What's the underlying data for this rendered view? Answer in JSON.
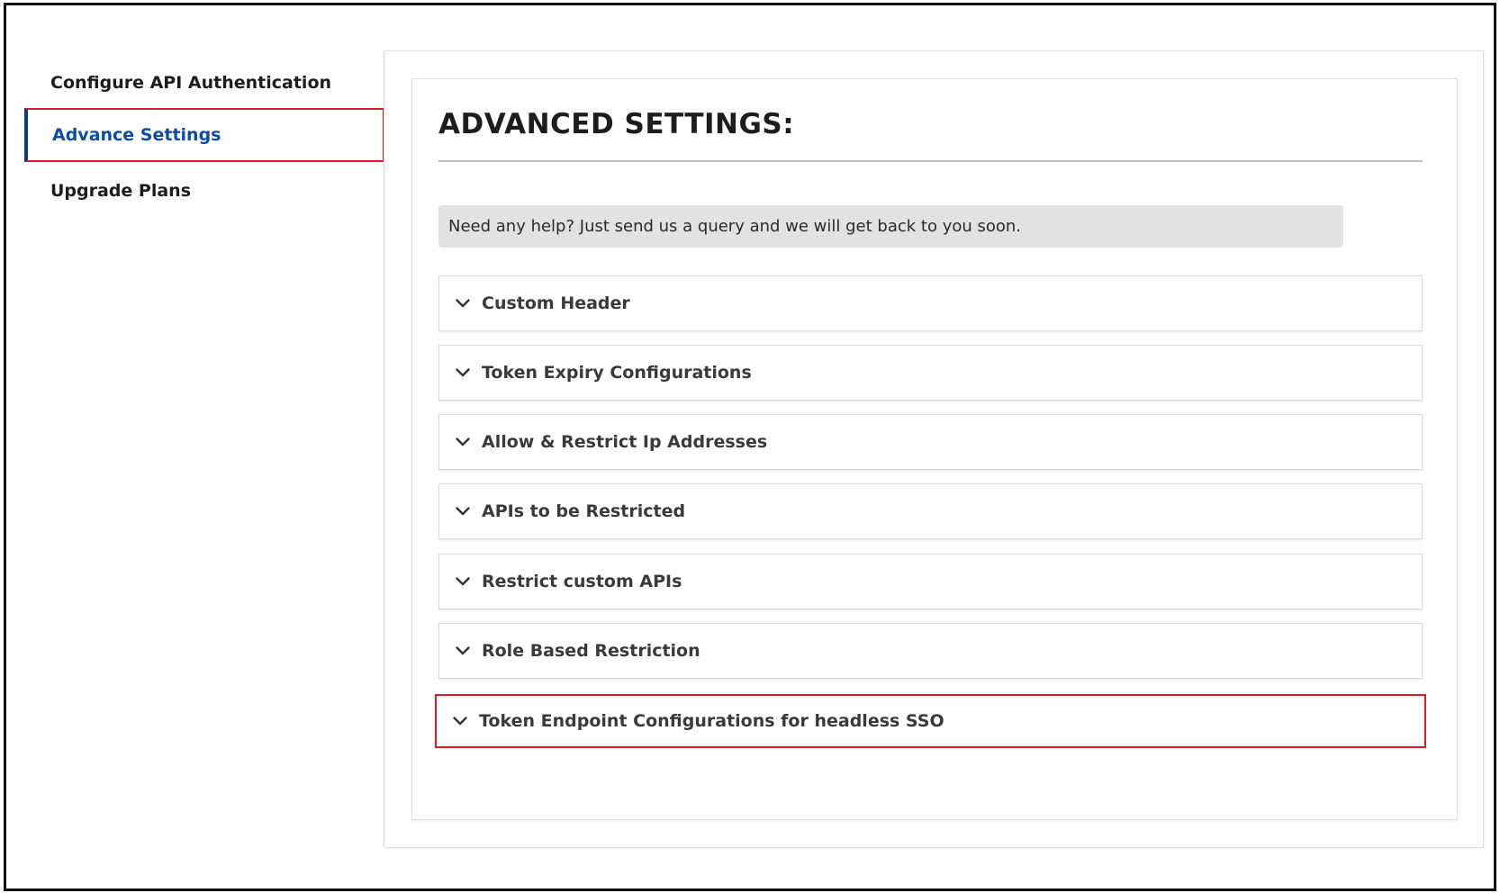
{
  "sidebar": {
    "items": [
      {
        "label": "Configure API Authentication",
        "active": false
      },
      {
        "label": "Advance Settings",
        "active": true
      },
      {
        "label": "Upgrade Plans",
        "active": false
      }
    ]
  },
  "main": {
    "title": "ADVANCED SETTINGS:",
    "help_text": "Need any help? Just send us a query and we will get back to you soon.",
    "sections": [
      {
        "label": "Custom Header",
        "icon": "chevron-down-icon"
      },
      {
        "label": "Token Expiry Configurations",
        "icon": "chevron-down-icon"
      },
      {
        "label": "Allow & Restrict Ip Addresses",
        "icon": "chevron-down-icon"
      },
      {
        "label": "APIs to be Restricted",
        "icon": "chevron-down-icon"
      },
      {
        "label": "Restrict custom APIs",
        "icon": "chevron-down-icon"
      },
      {
        "label": "Role Based Restriction",
        "icon": "chevron-down-icon"
      },
      {
        "label": "Token Endpoint Configurations for headless SSO",
        "icon": "chevron-down-icon",
        "highlighted": true
      }
    ]
  },
  "colors": {
    "active_nav": "#0b4ea2",
    "highlight_border": "#e01b24",
    "help_background": "#e2e2e2"
  }
}
